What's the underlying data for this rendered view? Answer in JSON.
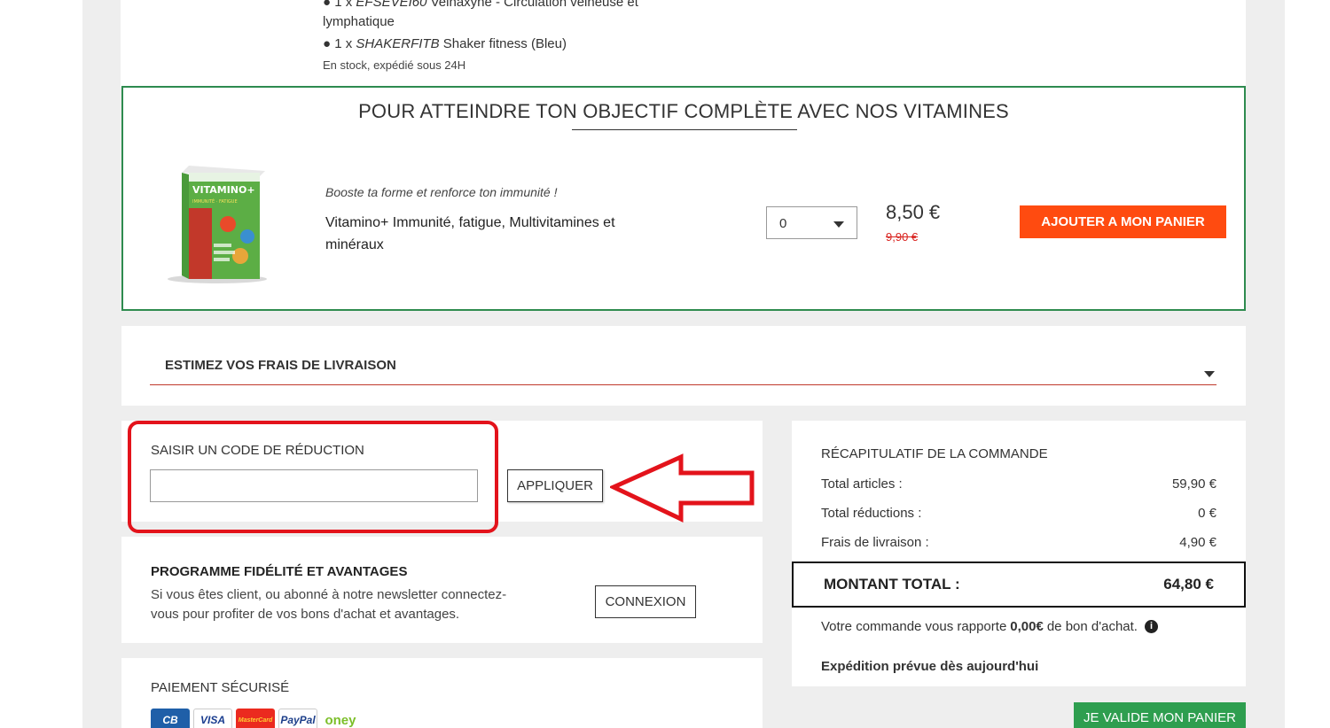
{
  "bundle": {
    "item1_prefix": "● 1 x ",
    "item1_code": "EFSEVEI60",
    "item1_name": " Veinaxyne - Circulation veineuse et",
    "item1_name_cont": "lymphatique",
    "item2_prefix": "● 1 x ",
    "item2_code": "SHAKERFITB",
    "item2_name": " Shaker fitness (Bleu)",
    "stock": "En stock, expédié sous 24H"
  },
  "upsell": {
    "title": "POUR ATTEINDRE TON OBJECTIF COMPLÈTE AVEC NOS VITAMINES",
    "tagline": "Booste ta forme et renforce ton immunité !",
    "product_name": "Vitamino+ Immunité, fatigue, Multivitamines et minéraux",
    "quantity": "0",
    "price_now": "8,50 €",
    "price_old": "9,90 €",
    "add_button": "AJOUTER A MON PANIER",
    "box_label": "VITAMINO+",
    "box_sub": "IMMUNITÉ · FATIGUE"
  },
  "shipping": {
    "label": "ESTIMEZ VOS FRAIS DE LIVRAISON"
  },
  "discount": {
    "label": "SAISIR UN CODE DE RÉDUCTION",
    "input_value": "",
    "input_placeholder": "",
    "apply_button": "APPLIQUER"
  },
  "loyalty": {
    "title": "PROGRAMME FIDÉLITÉ ET AVANTAGES",
    "text": "Si vous êtes client, ou abonné à notre newsletter connectez-vous pour profiter de vos bons d'achat et avantages.",
    "connect_button": "CONNEXION"
  },
  "payment": {
    "title": "PAIEMENT SÉCURISÉ",
    "logos": [
      "CB",
      "VISA",
      "MasterCard",
      "PayPal",
      "oney"
    ]
  },
  "summary": {
    "title": "RÉCAPITULATIF DE LA COMMANDE",
    "rows": [
      {
        "label": "Total articles :",
        "value": "59,90 €"
      },
      {
        "label": "Total réductions :",
        "value": "0 €"
      },
      {
        "label": "Frais de livraison :",
        "value": "4,90 €"
      }
    ],
    "total_label": "MONTANT TOTAL :",
    "total_value": "64,80 €",
    "reward_prefix": "Votre commande vous rapporte",
    "reward_amount": "0,00€",
    "reward_suffix": "de bon d'achat.",
    "shipping_date": "Expédition prévue dès aujourd'hui",
    "validate_button": "JE VALIDE MON PANIER"
  },
  "colors": {
    "accent_orange": "#ff4b10",
    "accent_green": "#2e9e4f",
    "annotation_red": "#e3131b",
    "old_price_red": "#d9231f"
  },
  "icons": [
    "chevron-down-icon",
    "info-icon",
    "arrow-annotation-icon"
  ]
}
